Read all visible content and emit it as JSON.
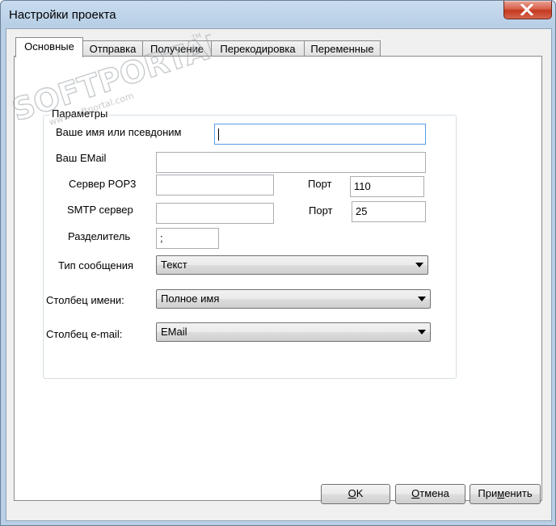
{
  "window": {
    "title": "Настройки проекта"
  },
  "tabs": [
    {
      "label": "Основные",
      "active": true
    },
    {
      "label": "Отправка",
      "active": false
    },
    {
      "label": "Получение",
      "active": false
    },
    {
      "label": "Перекодировка",
      "active": false
    },
    {
      "label": "Переменные",
      "active": false
    }
  ],
  "group": {
    "title": "Параметры"
  },
  "form": {
    "name_label": "Ваше имя или псевдоним",
    "name_value": "",
    "email_label": "Ваш EMail",
    "email_value": "",
    "pop3_label": "Сервер POP3",
    "pop3_value": "",
    "pop3_port_label": "Порт",
    "pop3_port_value": "110",
    "smtp_label": "SMTP сервер",
    "smtp_value": "",
    "smtp_port_label": "Порт",
    "smtp_port_value": "25",
    "separator_label": "Разделитель",
    "separator_value": ";",
    "message_type_label": "Тип сообщения",
    "message_type_value": "Текст",
    "name_column_label": "Столбец имени:",
    "name_column_value": "Полное имя",
    "email_column_label": "Столбец e-mail:",
    "email_column_value": "EMail"
  },
  "buttons": {
    "ok_accel": "O",
    "ok_rest": "K",
    "cancel_accel": "О",
    "cancel_rest": "тмена",
    "apply_pre": "При",
    "apply_accel": "м",
    "apply_rest": "енить"
  },
  "watermark": {
    "brand": "SOFTPORTAL",
    "url": "www.softportal.com",
    "tm": "TM"
  },
  "icons": {
    "close": "close-icon",
    "dropdown": "chevron-down-icon"
  }
}
